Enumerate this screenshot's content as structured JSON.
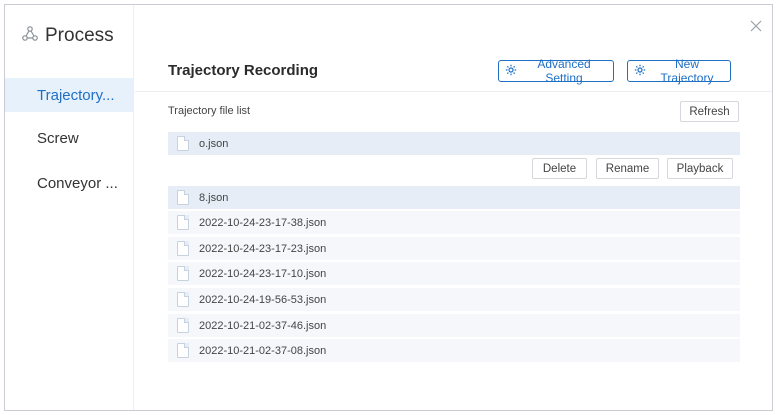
{
  "sidebar": {
    "title": "Process",
    "icon": "process-icon",
    "items": [
      {
        "label": "Trajectory...",
        "active": true
      },
      {
        "label": "Screw",
        "active": false
      },
      {
        "label": "Conveyor ...",
        "active": false
      }
    ]
  },
  "header": {
    "title": "Trajectory Recording",
    "advanced_setting_label": "Advanced Setting",
    "new_trajectory_label": "New Trajectory",
    "button_icon": "gear-icon",
    "close_icon": "close-icon"
  },
  "file_list": {
    "label": "Trajectory file list",
    "refresh_label": "Refresh",
    "actions": {
      "delete_label": "Delete",
      "rename_label": "Rename",
      "playback_label": "Playback"
    },
    "files": [
      {
        "name": "o.json",
        "selected": true
      },
      {
        "name": "8.json",
        "selected": false
      },
      {
        "name": "2022-10-24-23-17-38.json",
        "selected": false
      },
      {
        "name": "2022-10-24-23-17-23.json",
        "selected": false
      },
      {
        "name": "2022-10-24-23-17-10.json",
        "selected": false
      },
      {
        "name": "2022-10-24-19-56-53.json",
        "selected": false
      },
      {
        "name": "2022-10-21-02-37-46.json",
        "selected": false
      },
      {
        "name": "2022-10-21-02-37-08.json",
        "selected": false
      }
    ]
  },
  "colors": {
    "accent": "#1f6fc5",
    "active_bg": "#e7f1fb",
    "row_bg": "#f5f7fa",
    "selected_row_bg": "#e6edf6"
  }
}
